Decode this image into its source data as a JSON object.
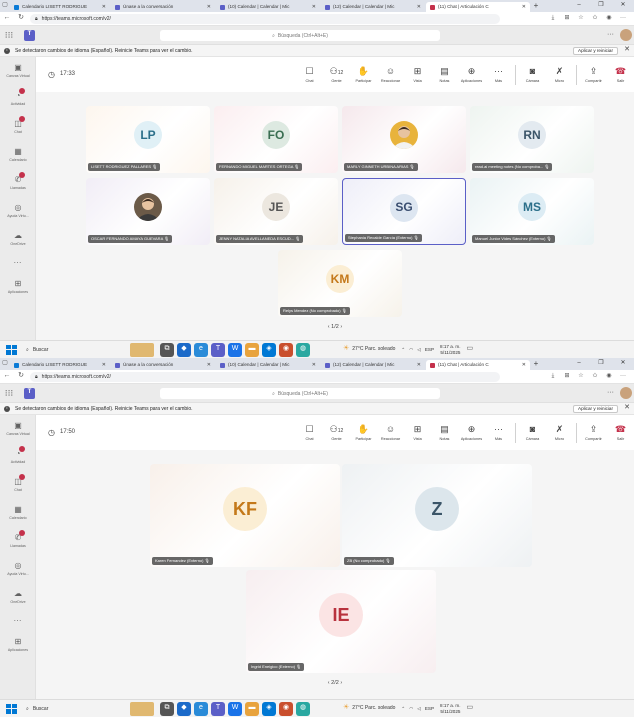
{
  "colors": {
    "accent": "#5b5fc7",
    "leave": "#c4314b",
    "name_label_bg": "#3c3c3c"
  },
  "browser": {
    "tabs": [
      {
        "label": "Calendario LISETT RODRIGUE",
        "favicon_color": "#0a7ad6",
        "active": false
      },
      {
        "label": "Únase a la conversación",
        "favicon_color": "#5b5fc7",
        "active": false
      },
      {
        "label": "(10) Calendar | Calendar | Mic",
        "favicon_color": "#5b5fc7",
        "active": false
      },
      {
        "label": "(12) Calendar | Calendar | Mic",
        "favicon_color": "#5b5fc7",
        "active": false
      },
      {
        "label": "(11) Chat | Articulación C",
        "favicon_color": "#c4314b",
        "active": true
      }
    ],
    "url": "https://teams.microsoft.com/v2/"
  },
  "teams": {
    "search_placeholder": "Búsqueda (Ctrl+Alt+E)",
    "banner_text": "Se detectaron cambios de idioma (Español). Reinicie Teams para ver el cambio.",
    "banner_button": "Aplicar y reiniciar",
    "rail": [
      {
        "label": "Canvas Virtual",
        "icon": "canvas-icon",
        "glyph": "▣",
        "badge": false
      },
      {
        "label": "Actividad",
        "icon": "bell-icon",
        "glyph": "◔",
        "badge": true
      },
      {
        "label": "Chat",
        "icon": "chat-icon",
        "glyph": "◫",
        "badge": true
      },
      {
        "label": "Calendario",
        "icon": "calendar-icon",
        "glyph": "▦",
        "badge": false
      },
      {
        "label": "Llamadas",
        "icon": "phone-icon",
        "glyph": "✆",
        "badge": true
      },
      {
        "label": "Ayuda Virtu...",
        "icon": "help-icon",
        "glyph": "◎",
        "badge": false
      },
      {
        "label": "OneDrive",
        "icon": "cloud-icon",
        "glyph": "☁",
        "badge": false
      }
    ],
    "rail_more": "···",
    "rail_apps": {
      "label": "Aplicaciones",
      "icon": "apps-icon",
      "glyph": "⊞"
    },
    "controls": [
      {
        "label": "Chat",
        "icon": "chat-icon",
        "glyph": "☐"
      },
      {
        "label": "Gente",
        "icon": "people-icon",
        "glyph": "⚇",
        "count": "12"
      },
      {
        "label": "Participar",
        "icon": "raise-hand-icon",
        "glyph": "✋"
      },
      {
        "label": "Reaccionar",
        "icon": "smile-icon",
        "glyph": "☺"
      },
      {
        "label": "Vista",
        "icon": "view-icon",
        "glyph": "⊞"
      },
      {
        "label": "Notas",
        "icon": "notes-icon",
        "glyph": "▤"
      },
      {
        "label": "Aplicaciones",
        "icon": "apps-icon",
        "glyph": "⊕"
      },
      {
        "label": "Más",
        "icon": "more-icon",
        "glyph": "···"
      },
      {
        "label": "Cámara",
        "icon": "camera-off-icon",
        "glyph": "◙"
      },
      {
        "label": "Micro",
        "icon": "mic-off-icon",
        "glyph": "✗"
      },
      {
        "label": "Compartir",
        "icon": "share-icon",
        "glyph": "⇪"
      },
      {
        "label": "Salir",
        "icon": "leave-icon",
        "glyph": "☎"
      }
    ]
  },
  "taskbar": {
    "search": "Buscar",
    "weather": "27°C  Parc. soleado",
    "lang": "ESP",
    "time": "8:17 a. m.",
    "date": "5/11/2025"
  },
  "screens": [
    {
      "timer": "17:33",
      "pager": "1/2",
      "participants": [
        {
          "initials": "LP",
          "name": "LISETT RODRIGUEZ PALLARES",
          "bg": "#fdf6ee",
          "avatar": "#e0f0f6",
          "ink": "#2b6f8a",
          "photo": false,
          "selected": false
        },
        {
          "initials": "FO",
          "name": "FERNANDO MIGUEL MARTES ORTEGA",
          "bg": "#fbeef0",
          "avatar": "#dde9e1",
          "ink": "#3a6e52",
          "photo": false,
          "selected": false
        },
        {
          "initials": "",
          "name": "MARLY GINNETH URBINA ARIAS",
          "bg": "#f5e8ec",
          "avatar": "#e8b33c",
          "ink": "#333",
          "photo": true,
          "selected": false
        },
        {
          "initials": "RN",
          "name": "read.ai meeting notes (No comproba...",
          "bg": "#eef4f0",
          "avatar": "#e3eaf0",
          "ink": "#3b5568",
          "photo": false,
          "selected": false
        },
        {
          "initials": "",
          "name": "OSCAR FERNANDO AMAYA GUEVARA",
          "bg": "#f1edf6",
          "avatar": "#6b5a48",
          "ink": "#333",
          "photo": true,
          "selected": false
        },
        {
          "initials": "JE",
          "name": "JENNY NATALIA AVELLANEDA ESCUD...",
          "bg": "#f6f1ea",
          "avatar": "#ece7df",
          "ink": "#555",
          "photo": false,
          "selected": false
        },
        {
          "initials": "SG",
          "name": "Stephania Recalde García (Externo)",
          "bg": "#eeeef8",
          "avatar": "#dde6f1",
          "ink": "#3a4e70",
          "photo": false,
          "selected": true
        },
        {
          "initials": "MS",
          "name": "Manuel Junior Vides Sánchez (Externo)",
          "bg": "#eaf3f4",
          "avatar": "#dcecf4",
          "ink": "#2b6f8a",
          "photo": false,
          "selected": false
        },
        {
          "initials": "KM",
          "name": "Relys Mendez (No comprobado)",
          "bg": "#f6f2ea",
          "avatar": "#fbeed4",
          "ink": "#c4791a",
          "photo": false,
          "selected": false
        }
      ]
    },
    {
      "timer": "17:50",
      "pager": "2/2",
      "participants": [
        {
          "initials": "KF",
          "name": "Karen Fernandez (Externo)",
          "bg": "#f8f0ea",
          "avatar": "#fbeed4",
          "ink": "#c4791a",
          "photo": false,
          "selected": false
        },
        {
          "initials": "Z",
          "name": "ZB (No comprobado)",
          "bg": "#eef1f3",
          "avatar": "#dce6ec",
          "ink": "#3b5568",
          "photo": false,
          "selected": false
        },
        {
          "initials": "IE",
          "name": "Ingrid Eneigico (Externo)",
          "bg": "#f7eef0",
          "avatar": "#fbe4e4",
          "ink": "#b8333e",
          "photo": false,
          "selected": false
        }
      ]
    }
  ]
}
